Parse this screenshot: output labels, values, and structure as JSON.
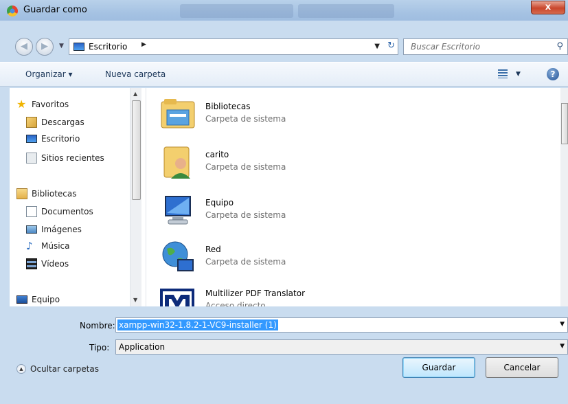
{
  "window": {
    "title": "Guardar como",
    "close_label": "x"
  },
  "address": {
    "location": "Escritorio",
    "search_placeholder": "Buscar Escritorio"
  },
  "toolbar": {
    "organize_label": "Organizar ▾",
    "new_folder_label": "Nueva carpeta",
    "help_label": "?"
  },
  "nav": {
    "favorites_label": "Favoritos",
    "favorites": [
      "Descargas",
      "Escritorio",
      "Sitios recientes"
    ],
    "libraries_label": "Bibliotecas",
    "libraries": [
      "Documentos",
      "Imágenes",
      "Música",
      "Vídeos"
    ],
    "computer_label": "Equipo"
  },
  "files": [
    {
      "name": "Bibliotecas",
      "type": "Carpeta de sistema",
      "icon": "library-folder-icon"
    },
    {
      "name": "carito",
      "type": "Carpeta de sistema",
      "icon": "user-folder-icon"
    },
    {
      "name": "Equipo",
      "type": "Carpeta de sistema",
      "icon": "computer-icon"
    },
    {
      "name": "Red",
      "type": "Carpeta de sistema",
      "icon": "network-icon"
    },
    {
      "name": "Multilizer PDF Translator",
      "type": "Acceso directo",
      "icon": "multilizer-app-icon"
    }
  ],
  "form": {
    "filename_label": "Nombre:",
    "filename_value": "xampp-win32-1.8.2-1-VC9-installer (1)",
    "type_label": "Tipo:",
    "type_value": "Application"
  },
  "footer": {
    "hide_folders_label": "Ocultar carpetas",
    "save_label": "Guardar",
    "cancel_label": "Cancelar"
  }
}
